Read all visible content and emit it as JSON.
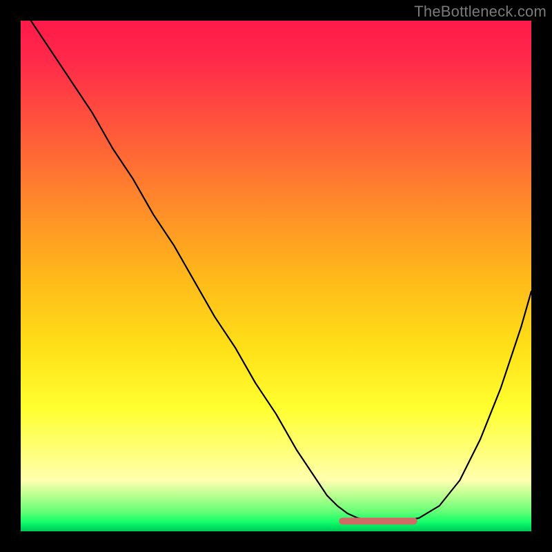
{
  "watermark": {
    "text": "TheBottleneck.com"
  },
  "chart_data": {
    "type": "line",
    "title": "",
    "xlabel": "",
    "ylabel": "",
    "xlim": [
      0,
      100
    ],
    "ylim": [
      0,
      100
    ],
    "series": [
      {
        "name": "curve",
        "color": "#000000",
        "x": [
          2,
          6,
          10,
          14,
          18,
          22,
          26,
          30,
          34,
          38,
          42,
          46,
          50,
          54,
          58,
          60,
          62,
          64,
          66,
          68,
          70,
          72,
          74,
          76,
          78,
          82,
          86,
          90,
          94,
          98,
          100
        ],
        "y": [
          100,
          94,
          88,
          82,
          75,
          69,
          62,
          56,
          49,
          42,
          36,
          29,
          23,
          16,
          10,
          7,
          5,
          3.5,
          2.6,
          2.2,
          2.0,
          2.0,
          2.0,
          2.2,
          2.6,
          5,
          10,
          18,
          28,
          40,
          47
        ]
      }
    ],
    "highlight": {
      "color": "#cf6a66",
      "x_range": [
        63,
        77
      ],
      "y": 2.0
    },
    "background_gradient": {
      "stops": [
        {
          "pos": 0.0,
          "color": "#ff1a4a"
        },
        {
          "pos": 0.5,
          "color": "#ffb81a"
        },
        {
          "pos": 0.76,
          "color": "#ffff30"
        },
        {
          "pos": 0.96,
          "color": "#6aff78"
        },
        {
          "pos": 1.0,
          "color": "#00c858"
        }
      ]
    }
  }
}
